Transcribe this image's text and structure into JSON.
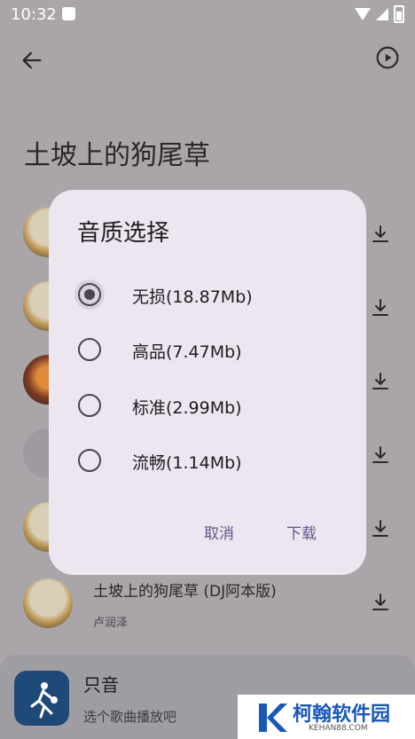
{
  "status_bar": {
    "time": "10:32"
  },
  "page": {
    "title": "土坡上的狗尾草"
  },
  "list": {
    "visible_song": {
      "title": "土坡上的狗尾草 (DJ阿本版)",
      "artist": "卢润泽"
    }
  },
  "player": {
    "title": "只音",
    "subtitle": "选个歌曲播放吧"
  },
  "dialog": {
    "title": "音质选择",
    "options": [
      {
        "label": "无损(18.87Mb)",
        "selected": true
      },
      {
        "label": "高品(7.47Mb)",
        "selected": false
      },
      {
        "label": "标准(2.99Mb)",
        "selected": false
      },
      {
        "label": "流畅(1.14Mb)",
        "selected": false
      }
    ],
    "cancel_label": "取消",
    "download_label": "下载"
  },
  "watermark": {
    "name": "柯翰软件园",
    "url": "KEHAN88.COM"
  },
  "colors": {
    "accent": "#65558f",
    "dialog_bg": "#ece6f0",
    "scrim_bg": "#a9a5a9"
  }
}
